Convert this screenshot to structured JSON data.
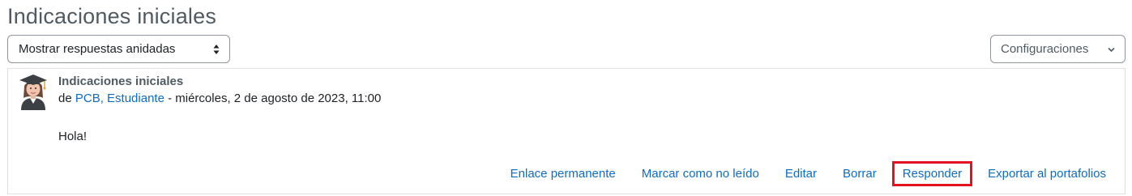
{
  "page": {
    "title": "Indicaciones iniciales"
  },
  "controls": {
    "display_mode": "Mostrar respuestas anidadas",
    "settings_label": "Configuraciones"
  },
  "post": {
    "subject": "Indicaciones iniciales",
    "by_prefix": "de ",
    "author": "PCB, Estudiante",
    "date_separator": " - ",
    "date": "miércoles, 2 de agosto de 2023, 11:00",
    "body": "Hola!",
    "avatar_icon": "graduate-avatar-icon"
  },
  "actions": [
    {
      "label": "Enlace permanente"
    },
    {
      "label": "Marcar como no leído"
    },
    {
      "label": "Editar"
    },
    {
      "label": "Borrar"
    },
    {
      "label": "Responder",
      "highlighted": true
    },
    {
      "label": "Exportar al portafolios"
    }
  ],
  "colors": {
    "link": "#0f6cbf",
    "highlight_border": "#e5111f",
    "title": "#505a63"
  }
}
